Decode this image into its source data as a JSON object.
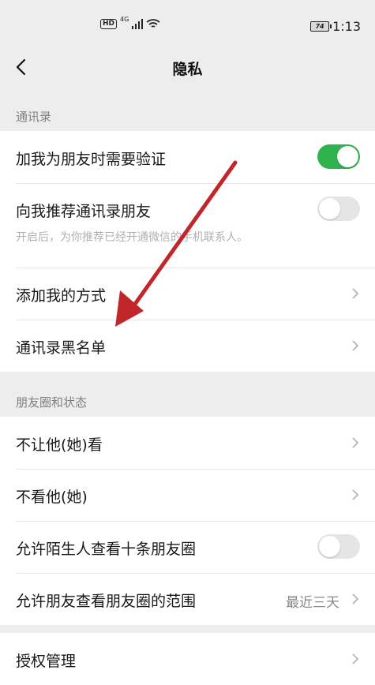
{
  "status_bar": {
    "hd": "HD",
    "network": "4G",
    "battery": "74",
    "time": "1:13"
  },
  "nav": {
    "title": "隐私"
  },
  "sections": {
    "contacts": {
      "label": "通讯录",
      "verify_label": "加我为朋友时需要验证",
      "verify_on": true,
      "recommend_label": "向我推荐通讯录朋友",
      "recommend_desc": "开启后，为你推荐已经开通微信的手机联系人。",
      "recommend_on": false,
      "add_methods_label": "添加我的方式",
      "blacklist_label": "通讯录黑名单"
    },
    "moments": {
      "label": "朋友圈和状态",
      "hide_mine_label": "不让他(她)看",
      "hide_theirs_label": "不看他(她)",
      "stranger_label": "允许陌生人查看十条朋友圈",
      "stranger_on": false,
      "range_label": "允许朋友查看朋友圈的范围",
      "range_value": "最近三天"
    },
    "auth": {
      "label": "授权管理"
    }
  },
  "colors": {
    "toggle_on": "#2fb34f",
    "toggle_off": "#e5e5e5",
    "annotation_arrow": "#c0262a"
  }
}
